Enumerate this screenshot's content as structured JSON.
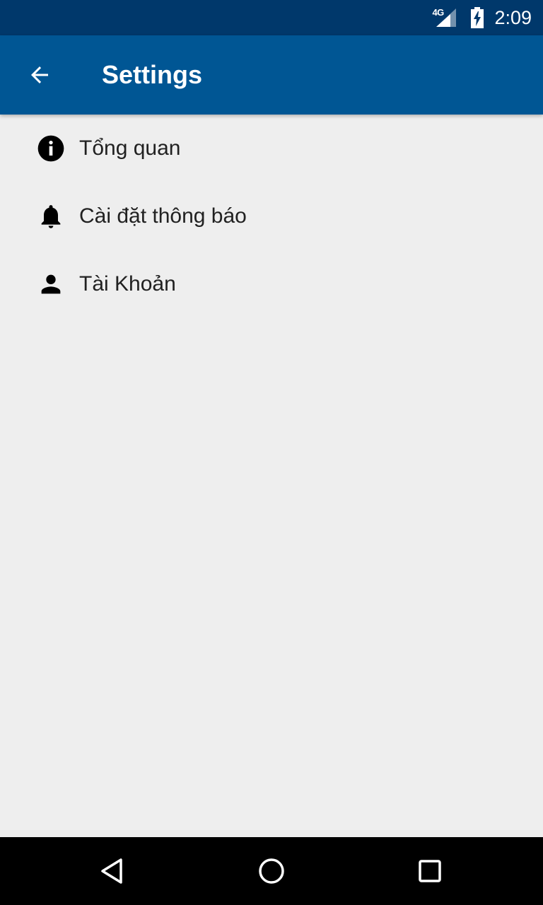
{
  "status_bar": {
    "network": "4G",
    "time": "2:09"
  },
  "app_bar": {
    "title": "Settings",
    "back_icon": "arrow-back-icon",
    "background_color": "#005694"
  },
  "settings": {
    "items": [
      {
        "icon": "info-icon",
        "label": "Tổng quan"
      },
      {
        "icon": "bell-icon",
        "label": "Cài đặt thông báo"
      },
      {
        "icon": "person-icon",
        "label": "Tài Khoản"
      }
    ]
  },
  "nav_bar": {
    "buttons": [
      "back-triangle-icon",
      "home-circle-icon",
      "recents-square-icon"
    ]
  }
}
